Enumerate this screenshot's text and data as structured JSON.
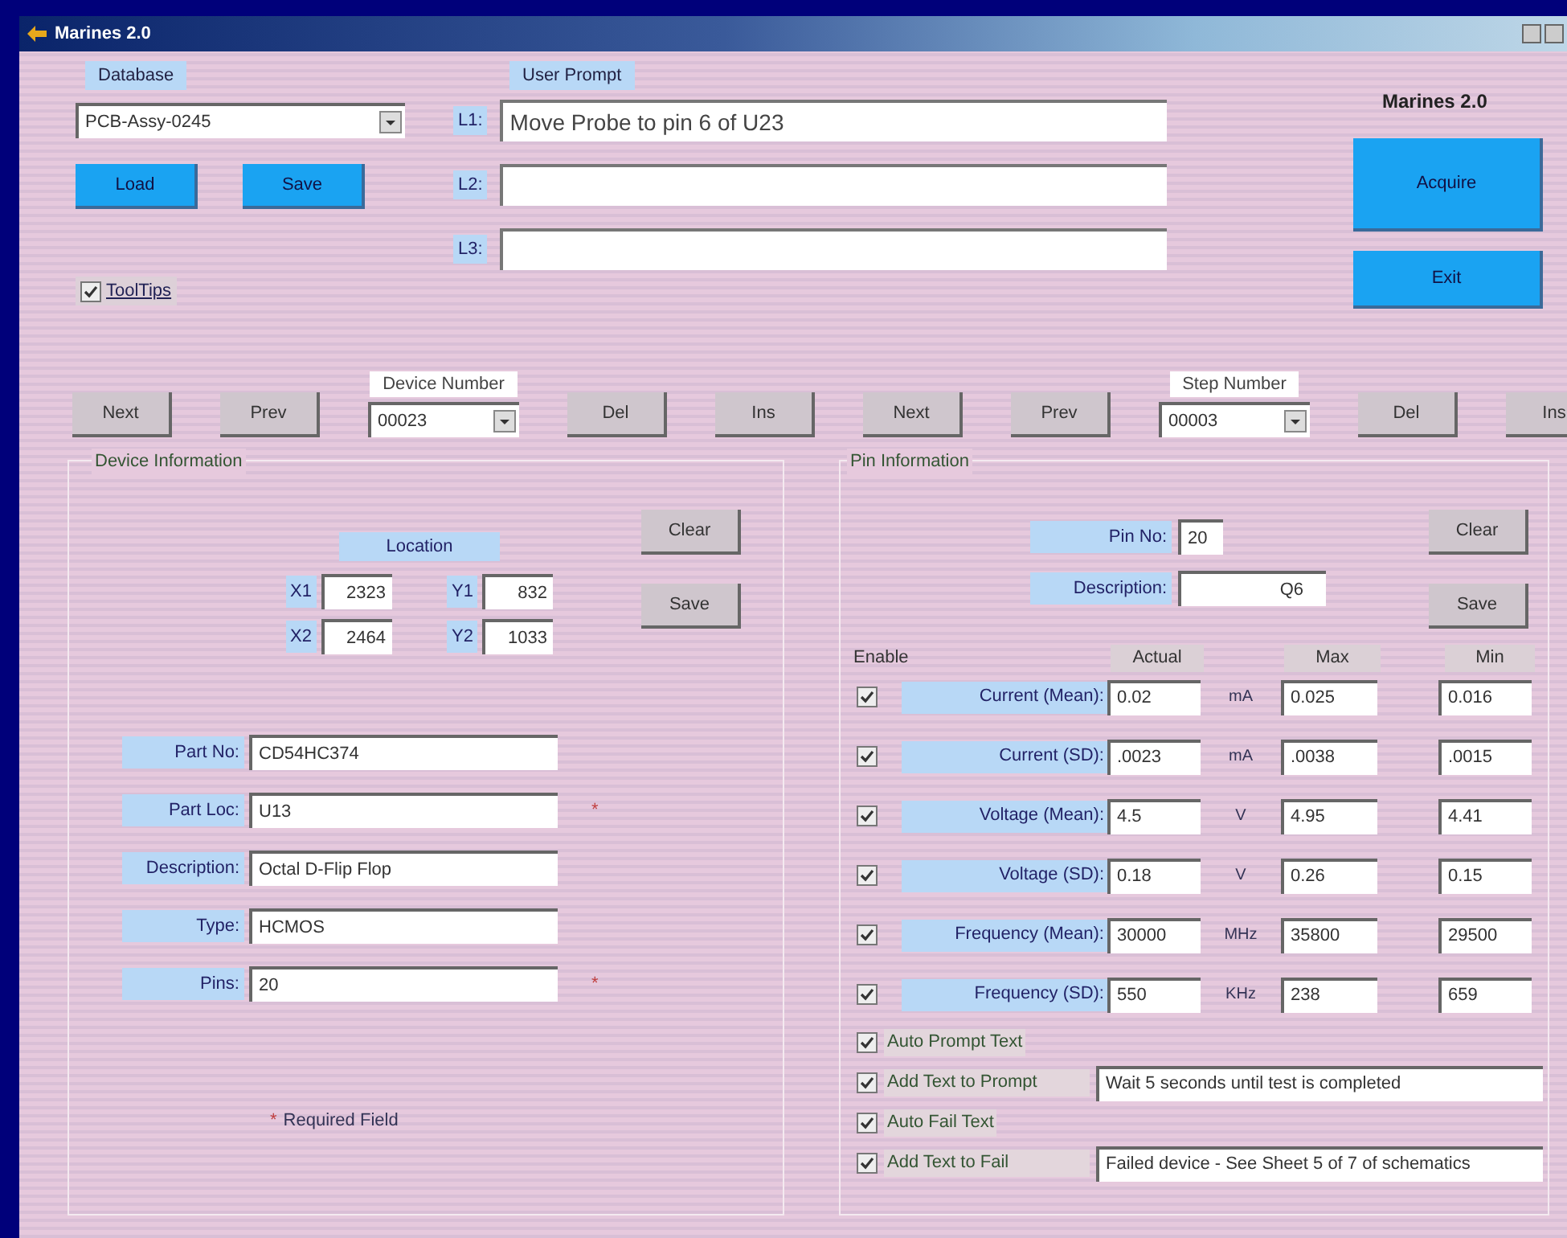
{
  "window": {
    "title": "Marines 2.0"
  },
  "app_label": "Marines 2.0",
  "database": {
    "label": "Database",
    "value": "PCB-Assy-0245",
    "buttons": [
      "Load",
      "Save"
    ],
    "tooltips": {
      "label": "ToolTips",
      "checked": true
    }
  },
  "prompt": {
    "label": "User Prompt",
    "lines": [
      {
        "label": "L1:",
        "value": "Move Probe to pin 6 of U23"
      },
      {
        "label": "L2:"
      },
      {
        "label": "L3:"
      }
    ]
  },
  "actions": [
    "Acquire",
    "Exit"
  ],
  "device_nav": {
    "label": "Device Number",
    "value": "00023",
    "buttons": [
      "Next",
      "Prev",
      "Del",
      "Ins"
    ]
  },
  "step_nav": {
    "label": "Step Number",
    "value": "00003",
    "buttons": [
      "Next",
      "Prev",
      "Del",
      "Ins"
    ]
  },
  "device_info": {
    "title": "Device Information",
    "buttons": [
      "Clear",
      "Save"
    ],
    "location_label": "Location",
    "coords": [
      {
        "label": "X1",
        "value": "2323"
      },
      {
        "label": "Y1",
        "value": "832"
      },
      {
        "label": "X2",
        "value": "2464"
      },
      {
        "label": "Y2",
        "value": "1033"
      }
    ],
    "fields": [
      {
        "label": "Part No:",
        "value": "CD54HC374",
        "required": false
      },
      {
        "label": "Part Loc:",
        "value": "U13",
        "required": true
      },
      {
        "label": "Description:",
        "value": "Octal D-Flip Flop",
        "required": false
      },
      {
        "label": "Type:",
        "value": "HCMOS",
        "required": false
      },
      {
        "label": "Pins:",
        "value": "20",
        "required": true
      }
    ],
    "required_mark": "*",
    "required_note": "Required Field"
  },
  "pin_info": {
    "title": "Pin Information",
    "buttons": [
      "Clear",
      "Save"
    ],
    "pin_no": {
      "label": "Pin No:",
      "value": "20"
    },
    "description": {
      "label": "Description:",
      "value": "Q6"
    },
    "headers": [
      "Enable",
      "Actual",
      "Max",
      "Min"
    ],
    "rows": [
      {
        "enabled": true,
        "label": "Current (Mean):",
        "actual": "0.02",
        "unit": "mA",
        "max": "0.025",
        "min": "0.016"
      },
      {
        "enabled": true,
        "label": "Current (SD):",
        "actual": ".0023",
        "unit": "mA",
        "max": ".0038",
        "min": ".0015"
      },
      {
        "enabled": true,
        "label": "Voltage (Mean):",
        "actual": "4.5",
        "unit": "V",
        "max": "4.95",
        "min": "4.41"
      },
      {
        "enabled": true,
        "label": "Voltage (SD):",
        "actual": "0.18",
        "unit": "V",
        "max": "0.26",
        "min": "0.15"
      },
      {
        "enabled": true,
        "label": "Frequency (Mean):",
        "actual": "30000",
        "unit": "MHz",
        "max": "35800",
        "min": "29500"
      },
      {
        "enabled": true,
        "label": "Frequency (SD):",
        "actual": "550",
        "unit": "KHz",
        "max": "238",
        "min": "659"
      }
    ],
    "options": [
      {
        "kind": "check",
        "label": "Auto Prompt Text",
        "checked": true
      },
      {
        "kind": "check_field",
        "label": "Add Text to Prompt",
        "checked": true,
        "value": "Wait 5 seconds until test is completed"
      },
      {
        "kind": "check",
        "label": "Auto Fail Text",
        "checked": true
      },
      {
        "kind": "check_field",
        "label": "Add Text to Fail",
        "checked": true,
        "value": "Failed device - See Sheet 5 of 7 of schematics"
      }
    ]
  }
}
